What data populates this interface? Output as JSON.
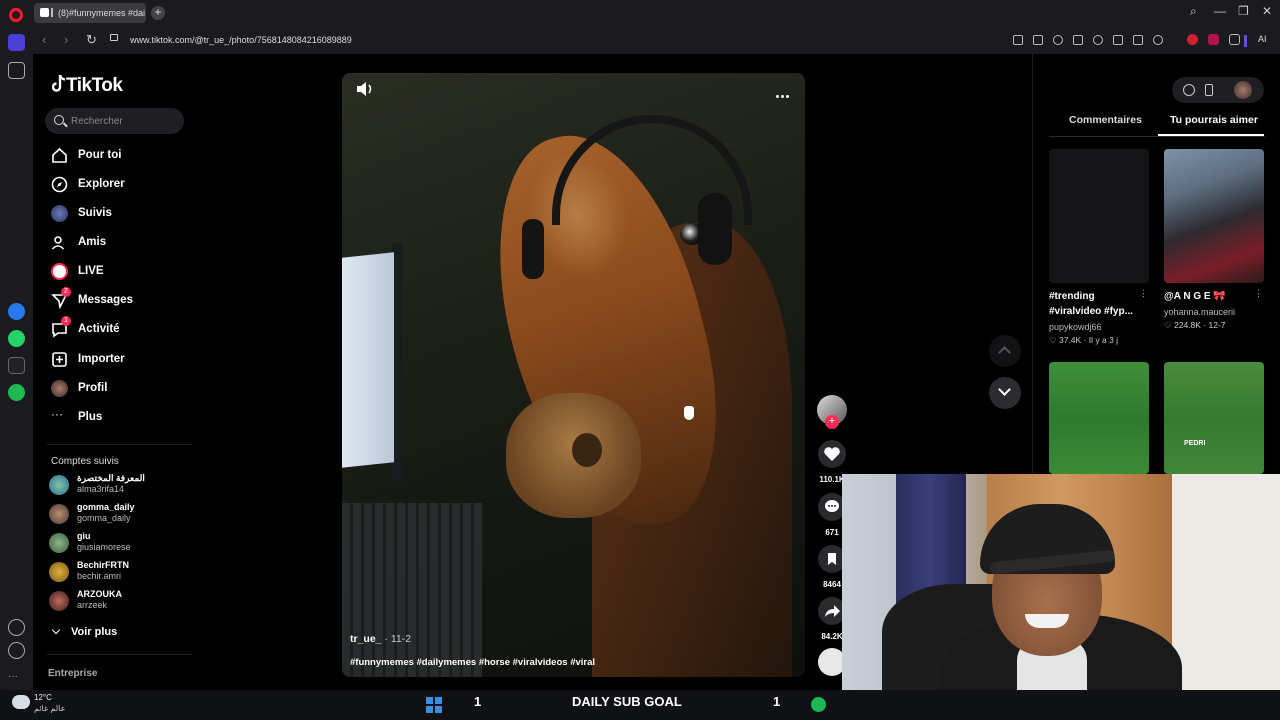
{
  "browser": {
    "tab_title": "(8)#funnymemes #dai",
    "url": "www.tiktok.com/@tr_ue_/photo/7568148084216089889",
    "new_tab_label": "+",
    "ai_label": "AI"
  },
  "tiktok": {
    "logo": "TikTok",
    "search_placeholder": "Rechercher",
    "nav": [
      {
        "label": "Pour toi",
        "icon": "home-icon"
      },
      {
        "label": "Explorer",
        "icon": "compass-icon"
      },
      {
        "label": "Suivis",
        "icon": "following-avatar-icon"
      },
      {
        "label": "Amis",
        "icon": "friends-icon"
      },
      {
        "label": "LIVE",
        "icon": "live-icon"
      },
      {
        "label": "Messages",
        "icon": "messages-icon",
        "badge": "2"
      },
      {
        "label": "Activité",
        "icon": "activity-icon",
        "badge": "1"
      },
      {
        "label": "Importer",
        "icon": "upload-icon"
      },
      {
        "label": "Profil",
        "icon": "profile-avatar-icon"
      },
      {
        "label": "Plus",
        "icon": "more-dots-icon"
      }
    ],
    "following_title": "Comptes suivis",
    "following": [
      {
        "name": "المعرفة المختصرة",
        "handle": "alma3rifa14"
      },
      {
        "name": "gomma_daily",
        "handle": "gomma_daily"
      },
      {
        "name": "giu",
        "handle": "giusiamorese"
      },
      {
        "name": "BechirFRTN",
        "handle": "bechir.amri"
      },
      {
        "name": "ARZOUKA",
        "handle": "arrzeek"
      }
    ],
    "see_more": "Voir plus",
    "enterprise": "Entreprise"
  },
  "post": {
    "author": "tr_ue_",
    "date": " · 11-2",
    "hashtags": "#funnymemes #dailymemes #horse #viralvideos #viral",
    "likes": "110.1K",
    "comments": "671",
    "saves": "8464",
    "shares": "84.2K"
  },
  "right_panel": {
    "tab_comments": "Commentaires",
    "tab_might_like": "Tu pourrais aimer",
    "cards": [
      {
        "title": "#trending #viralvideo #fyp...",
        "user": "pupykowdj66",
        "likes": "37.4K",
        "date": "Il y a 3 j"
      },
      {
        "title": "@A N G E 🎀",
        "user": "yohanna.maucerii",
        "likes": "224.8K",
        "date": "12-7"
      },
      {
        "title": "",
        "user": "",
        "likes": "",
        "date": ""
      },
      {
        "title": "",
        "user": "",
        "likes": "",
        "date": "",
        "overlay": "PEDRI"
      }
    ]
  },
  "taskbar": {
    "weather_temp": "12°C",
    "weather_desc": "عالم غائم",
    "goal_left": "1",
    "goal_label": "DAILY SUB GOAL",
    "goal_right": "1"
  },
  "colors": {
    "accent": "#fe2c55",
    "background": "#000000",
    "sidebar_bg": "#1b1b1f"
  }
}
